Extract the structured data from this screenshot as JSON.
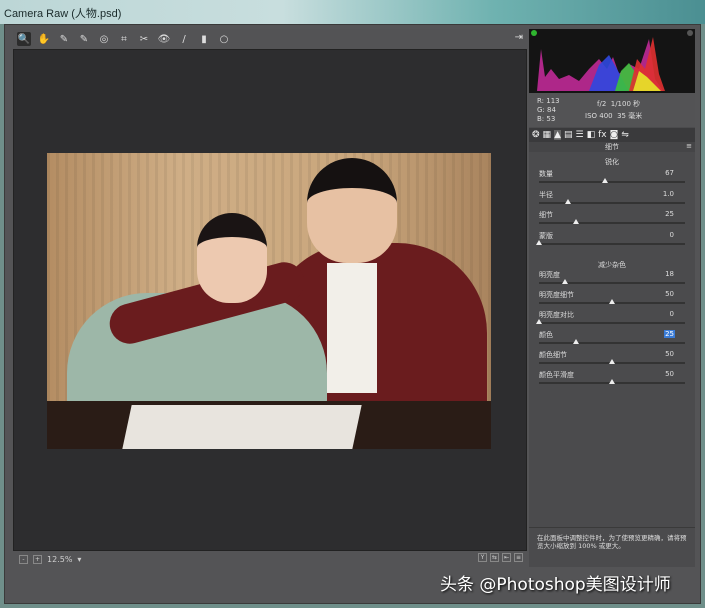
{
  "window": {
    "title": "Camera Raw (人物.psd)"
  },
  "toolbar": {
    "tools": [
      {
        "name": "zoom-tool",
        "glyph": "🔍"
      },
      {
        "name": "hand-tool",
        "glyph": "✋"
      },
      {
        "name": "white-balance-tool",
        "glyph": "✎"
      },
      {
        "name": "color-sampler-tool",
        "glyph": "✎"
      },
      {
        "name": "targeted-adjustment-tool",
        "glyph": "◎"
      },
      {
        "name": "crop-tool",
        "glyph": "⌗"
      },
      {
        "name": "spot-removal-tool",
        "glyph": "✂"
      },
      {
        "name": "red-eye-tool",
        "glyph": "👁"
      },
      {
        "name": "adjustment-brush-tool",
        "glyph": "/"
      },
      {
        "name": "graduated-filter-tool",
        "glyph": "▮"
      },
      {
        "name": "radial-filter-tool",
        "glyph": "○"
      }
    ],
    "export_glyph": "⇥"
  },
  "status": {
    "zoom": "12.5%",
    "zoom_arrow": "▾",
    "btn_y": "Y"
  },
  "info": {
    "r_label": "R:",
    "r": "113",
    "g_label": "G:",
    "g": "84",
    "b_label": "B:",
    "b": "53",
    "aperture": "f/2",
    "shutter": "1/100 秒",
    "iso": "ISO 400",
    "focal": "35 毫米"
  },
  "panel": {
    "title": "细节",
    "sharpen_title": "锐化",
    "sharpen": [
      {
        "label": "数量",
        "value": "67",
        "pct": 45
      },
      {
        "label": "半径",
        "value": "1.0",
        "pct": 20
      },
      {
        "label": "细节",
        "value": "25",
        "pct": 25
      },
      {
        "label": "蒙版",
        "value": "0",
        "pct": 0
      }
    ],
    "noise_title": "减少杂色",
    "noise": [
      {
        "label": "明亮度",
        "value": "18",
        "pct": 18
      },
      {
        "label": "明亮度细节",
        "value": "50",
        "pct": 50
      },
      {
        "label": "明亮度对比",
        "value": "0",
        "pct": 0
      },
      {
        "label": "颜色",
        "value": "25",
        "pct": 25,
        "selected": true
      },
      {
        "label": "颜色细节",
        "value": "50",
        "pct": 50
      },
      {
        "label": "颜色平滑度",
        "value": "50",
        "pct": 50
      }
    ],
    "note": "在此面板中调整控件时，为了使预览更精确，请将预览大小缩放到 100% 或更大。"
  },
  "watermark": "头条 @Photoshop美图设计师"
}
